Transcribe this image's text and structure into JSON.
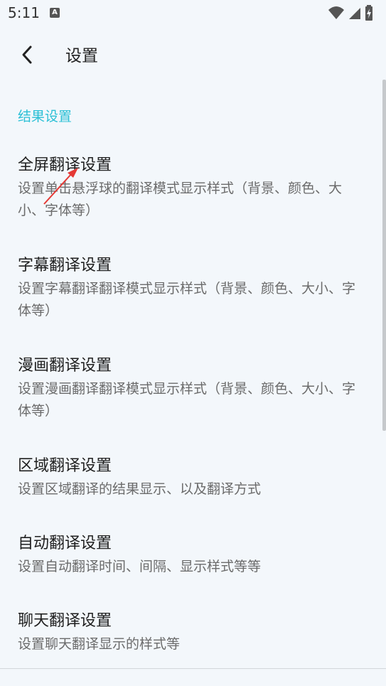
{
  "status_bar": {
    "time": "5:11",
    "notification_icon": "a-icon",
    "notification_letter": "A",
    "icons": [
      "wifi-icon",
      "signal-icon",
      "battery-charging-icon"
    ]
  },
  "app_bar": {
    "back_icon": "chevron-left-icon",
    "title": "设置"
  },
  "section": {
    "header": "结果设置",
    "accent_color": "#2bc0d6"
  },
  "settings": [
    {
      "title": "全屏翻译设置",
      "subtitle": "设置单击悬浮球的翻译模式显示样式（背景、颜色、大小、字体等）"
    },
    {
      "title": "字幕翻译设置",
      "subtitle": "设置字幕翻译翻译模式显示样式（背景、颜色、大小、字体等）"
    },
    {
      "title": "漫画翻译设置",
      "subtitle": "设置漫画翻译翻译模式显示样式（背景、颜色、大小、字体等）"
    },
    {
      "title": "区域翻译设置",
      "subtitle": "设置区域翻译的结果显示、以及翻译方式"
    },
    {
      "title": "自动翻译设置",
      "subtitle": "设置自动翻译时间、间隔、显示样式等等"
    },
    {
      "title": "聊天翻译设置",
      "subtitle": "设置聊天翻译显示的样式等"
    }
  ],
  "annotation": {
    "icon": "red-arrow-icon",
    "color": "#e53935"
  }
}
